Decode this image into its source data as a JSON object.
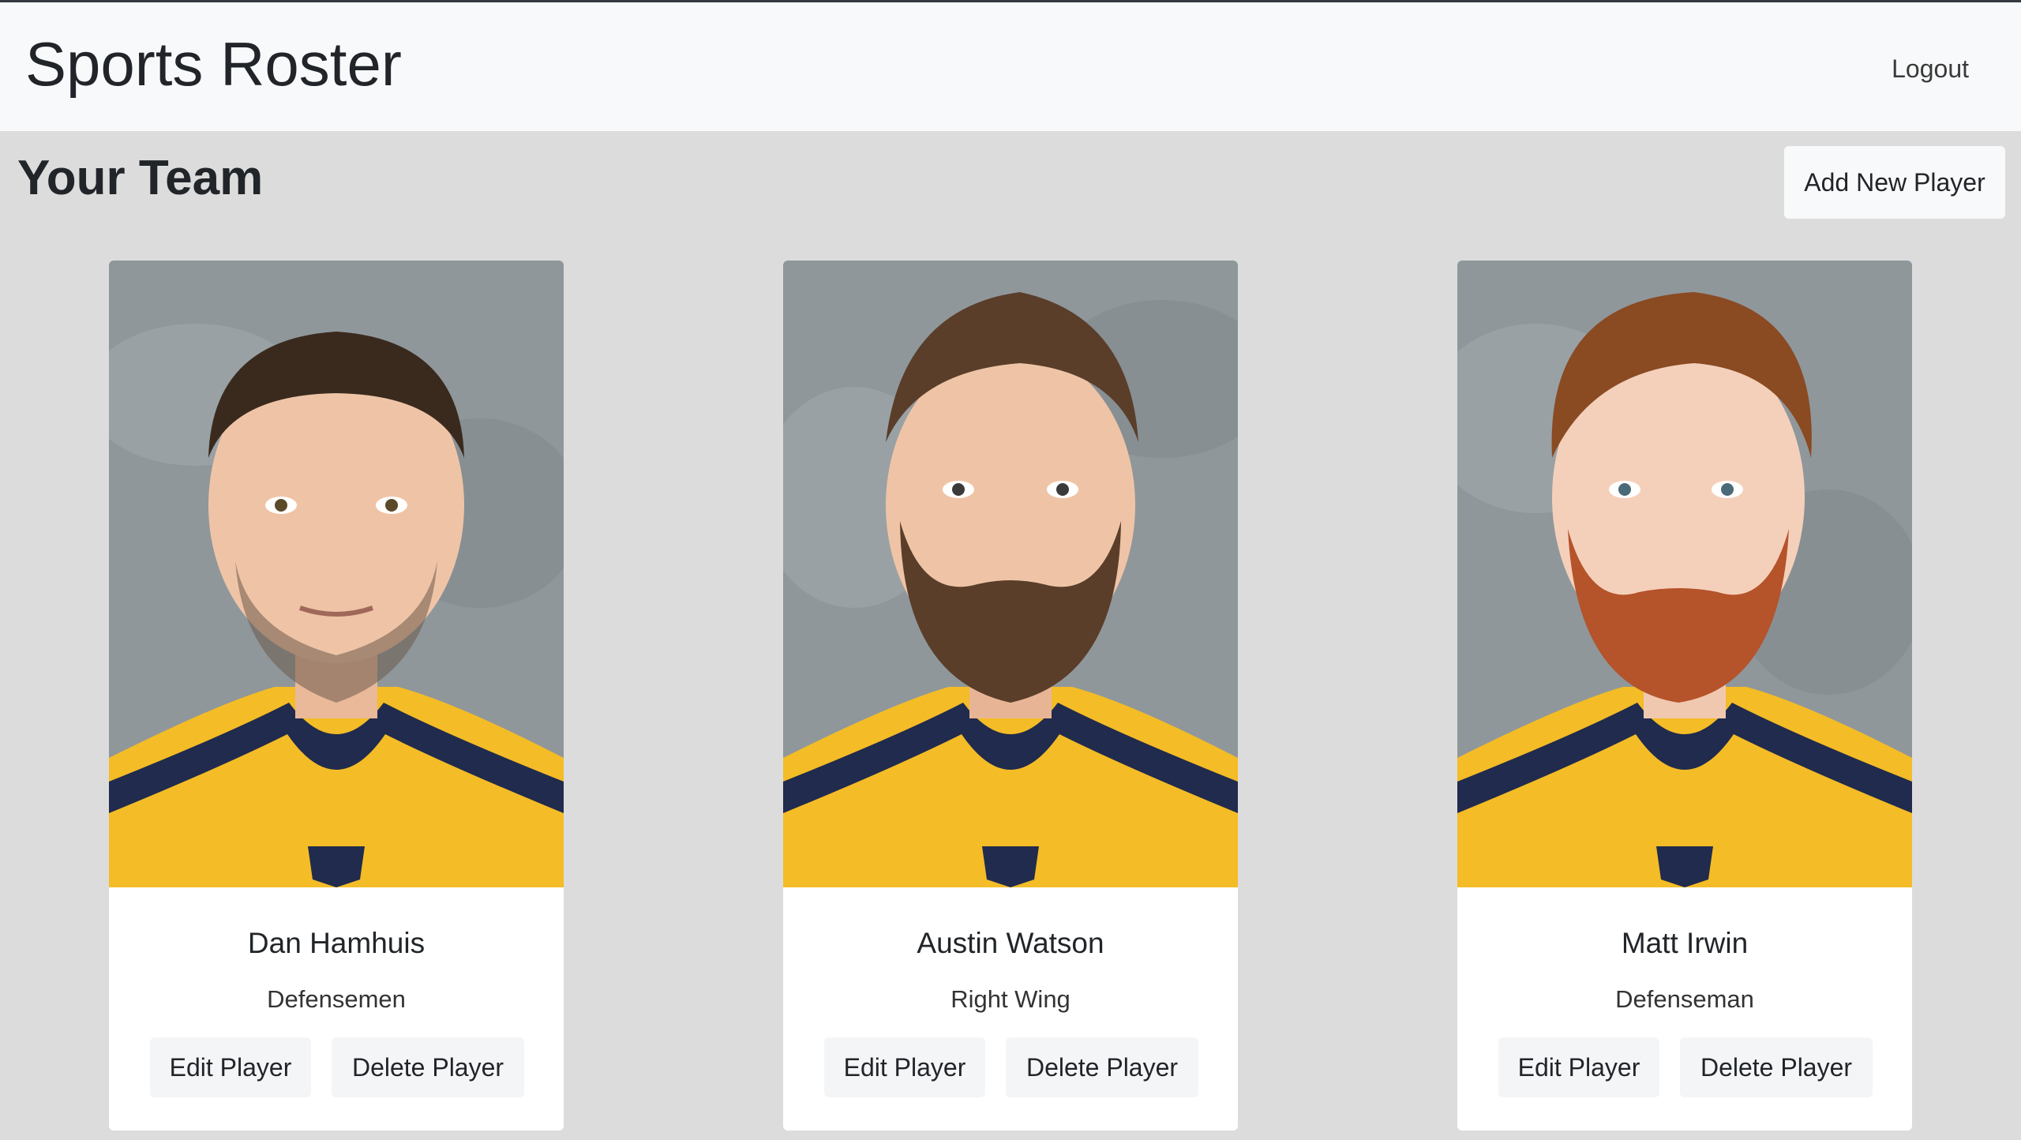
{
  "app": {
    "title": "Sports Roster",
    "logout_label": "Logout"
  },
  "team": {
    "heading": "Your Team",
    "add_label": "Add New Player"
  },
  "players": [
    {
      "name": "Dan Hamhuis",
      "position": "Defensemen",
      "edit_label": "Edit Player",
      "delete_label": "Delete Player",
      "hair": "#3a2a1e",
      "beard": "#6b5a4a"
    },
    {
      "name": "Austin Watson",
      "position": "Right Wing",
      "edit_label": "Edit Player",
      "delete_label": "Delete Player",
      "hair": "#5a3e2a",
      "beard": "#5a3e2a"
    },
    {
      "name": "Matt Irwin",
      "position": "Defenseman",
      "edit_label": "Edit Player",
      "delete_label": "Delete Player",
      "hair": "#8a4a22",
      "beard": "#b5532a"
    }
  ],
  "colors": {
    "navbar_bg": "#f8f9fa",
    "page_bg": "#dcdcdc",
    "jersey_gold": "#f4bc26",
    "jersey_navy": "#202b4d",
    "photo_bg": "#8f979b"
  }
}
